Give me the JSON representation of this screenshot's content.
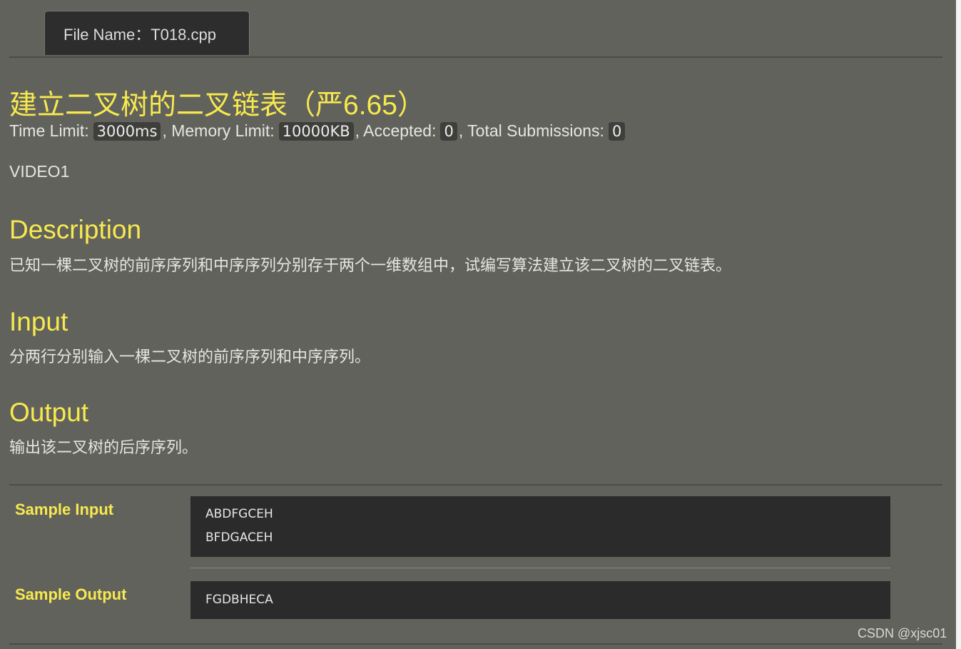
{
  "tab": {
    "label": "File Name：T018.cpp"
  },
  "problem": {
    "title": "建立二叉树的二叉链表（严6.65）",
    "limits": {
      "time_label": "Time Limit:",
      "time_value": "3000ms",
      "memory_label": ", Memory Limit:",
      "memory_value": "10000KB",
      "accepted_label": ", Accepted:",
      "accepted_value": "0",
      "submissions_label": ", Total Submissions:",
      "submissions_value": "0"
    },
    "source": "VIDEO1"
  },
  "sections": {
    "description": {
      "heading": "Description",
      "text": "已知一棵二叉树的前序序列和中序序列分别存于两个一维数组中，试编写算法建立该二叉树的二叉链表。"
    },
    "input": {
      "heading": "Input",
      "text": "分两行分别输入一棵二叉树的前序序列和中序序列。"
    },
    "output": {
      "heading": "Output",
      "text": "输出该二叉树的后序序列。"
    }
  },
  "samples": {
    "input_label": "Sample Input",
    "input_lines": [
      "ABDFGCEH",
      "BFDGACEH"
    ],
    "output_label": "Sample Output",
    "output_lines": [
      "FGDBHECA"
    ]
  },
  "watermark": "CSDN @xjsc01"
}
